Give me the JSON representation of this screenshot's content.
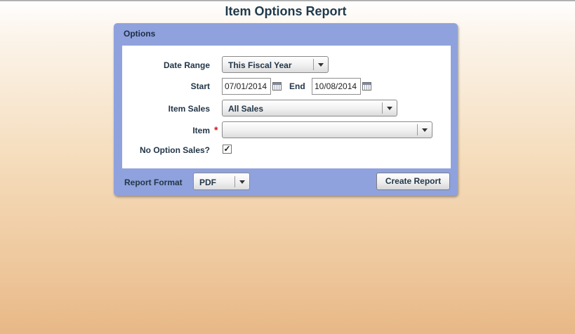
{
  "page": {
    "title": "Item Options Report"
  },
  "panel": {
    "header": "Options"
  },
  "form": {
    "date_range": {
      "label": "Date Range",
      "value": "This Fiscal Year"
    },
    "start": {
      "label": "Start",
      "value": "07/01/2014"
    },
    "end": {
      "label": "End",
      "value": "10/08/2014"
    },
    "item_sales": {
      "label": "Item Sales",
      "value": "All Sales"
    },
    "item": {
      "label": "Item",
      "required_mark": "*",
      "value": ""
    },
    "no_option_sales": {
      "label": "No Option Sales?",
      "checked": true,
      "check_glyph": "✓"
    }
  },
  "footer": {
    "report_format_label": "Report Format",
    "report_format_value": "PDF",
    "create_button": "Create Report"
  },
  "colors": {
    "panel_bg": "#8fa2dd",
    "title": "#1f3a4c",
    "required": "#d01818"
  }
}
